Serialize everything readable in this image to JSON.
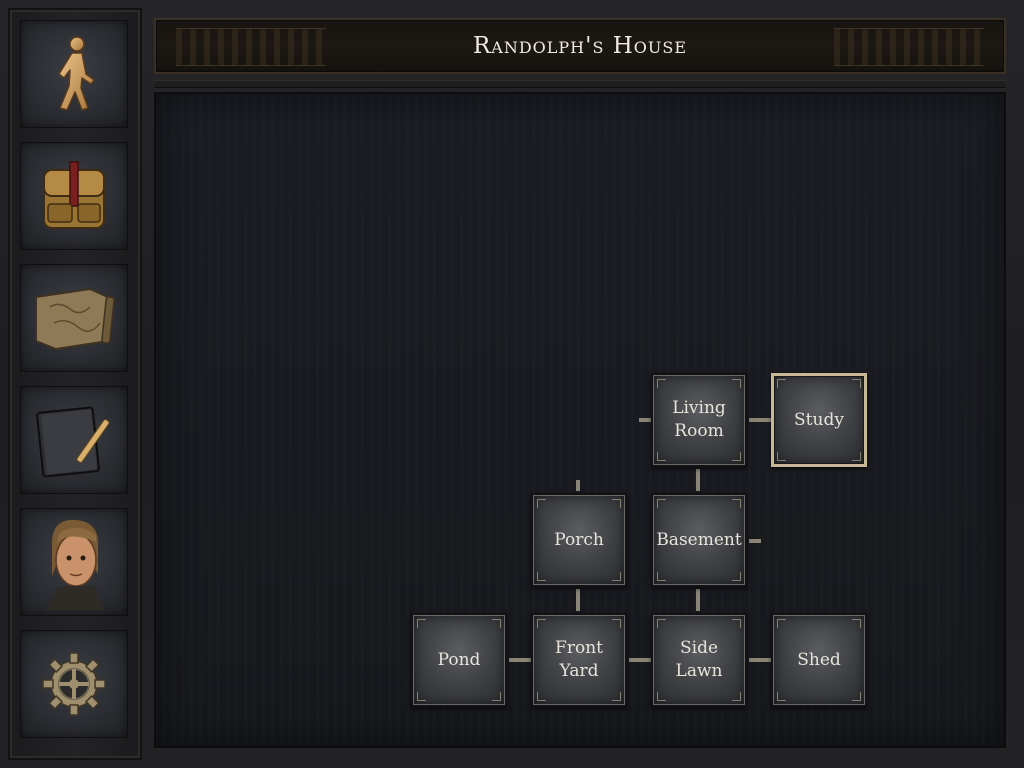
{
  "location": {
    "title": "Randolph's House"
  },
  "sidebar": {
    "items": [
      {
        "icon": "walking-figure-icon",
        "action": "move"
      },
      {
        "icon": "backpack-icon",
        "action": "inventory"
      },
      {
        "icon": "map-scroll-icon",
        "action": "map"
      },
      {
        "icon": "journal-pencil-icon",
        "action": "journal"
      },
      {
        "icon": "character-portrait-icon",
        "action": "character"
      },
      {
        "icon": "gear-icon",
        "action": "settings"
      }
    ]
  },
  "map": {
    "current_room": "Study",
    "rooms": {
      "living_room": "Living\nRoom",
      "study": "Study",
      "porch": "Porch",
      "basement": "Basement",
      "pond": "Pond",
      "front_yard": "Front\nYard",
      "side_lawn": "Side\nLawn",
      "shed": "Shed"
    }
  },
  "colors": {
    "current_room_border": "#c8b898",
    "title_text": "#f1ece1",
    "connector": "#8a8475"
  }
}
